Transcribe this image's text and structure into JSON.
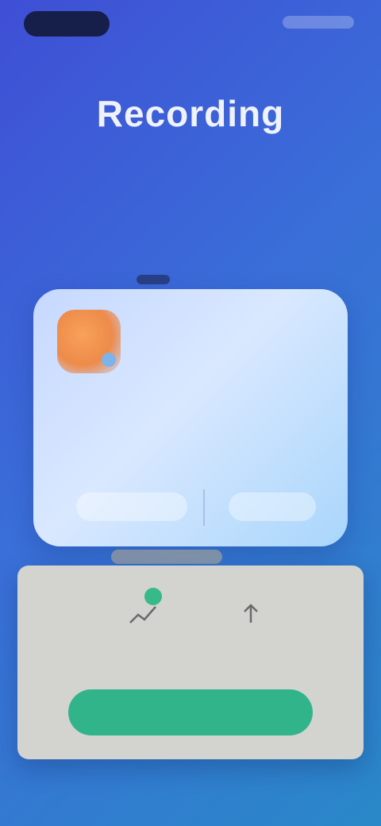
{
  "status_bar": {
    "time": "",
    "indicators": ""
  },
  "hero": {
    "title": "Recording",
    "subtitle": ""
  },
  "card": {
    "app_icon": "app-icon",
    "headline": "",
    "description": "",
    "buttons": [
      "",
      ""
    ]
  },
  "tray": {
    "items": [
      {
        "icon": "chart-icon",
        "label": ""
      },
      {
        "icon": "upload-icon",
        "label": ""
      }
    ],
    "primary_button": ""
  },
  "colors": {
    "background_start": "#3f4fd6",
    "background_end": "#2a88c8",
    "card": "#c6d8ff",
    "tray": "#d3d3d0",
    "accent_green": "#32b48a",
    "app_icon_orange": "#ee8b4a"
  }
}
